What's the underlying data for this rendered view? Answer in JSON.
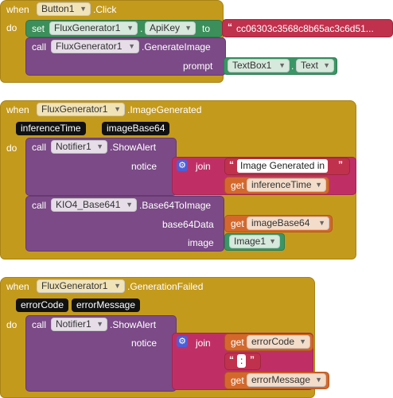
{
  "block1": {
    "when": "when",
    "component": "Button1",
    "event": ".Click",
    "do": "do",
    "set": "set",
    "set_component": "FluxGenerator1",
    "set_property": "ApiKey",
    "to": "to",
    "api_key_value": "cc06303c3568c8b65ac3c6d51...",
    "call": "call",
    "call_component": "FluxGenerator1",
    "call_method": ".GenerateImage",
    "prompt": "prompt",
    "textbox": "TextBox1",
    "textbox_prop": "Text"
  },
  "block2": {
    "when": "when",
    "component": "FluxGenerator1",
    "event": ".ImageGenerated",
    "param1": "inferenceTime",
    "param2": "imageBase64",
    "do": "do",
    "call1": "call",
    "notifier": "Notifier1",
    "show_alert": ".ShowAlert",
    "notice": "notice",
    "join": "join",
    "text1": "Image Generated in",
    "get": "get",
    "get_var": "inferenceTime",
    "call2": "call",
    "kio": "KIO4_Base641",
    "to_image": ".Base64ToImage",
    "base64data": "base64Data",
    "get2": "get",
    "get_var2": "imageBase64",
    "image": "image",
    "image_comp": "Image1"
  },
  "block3": {
    "when": "when",
    "component": "FluxGenerator1",
    "event": ".GenerationFailed",
    "param1": "errorCode",
    "param2": "errorMessage",
    "do": "do",
    "call": "call",
    "notifier": "Notifier1",
    "show_alert": ".ShowAlert",
    "notice": "notice",
    "join": "join",
    "get1": "get",
    "var1": "errorCode",
    "sep": ":",
    "get2": "get",
    "var2": "errorMessage"
  },
  "icons": {
    "dropdown": "chevron-down-icon",
    "gear": "gear-icon"
  },
  "colors": {
    "event": "#c49a1d",
    "procedure": "#7b4a87",
    "setter": "#3c8f5b",
    "text": "#c0314d",
    "variable": "#d4682c",
    "join": "#bf2f66"
  }
}
